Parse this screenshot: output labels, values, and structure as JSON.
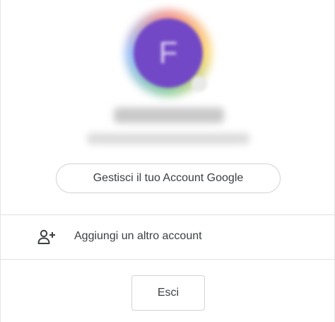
{
  "account": {
    "avatar_initial": "F",
    "avatar_color": "#7248c6"
  },
  "actions": {
    "manage_account_label": "Gestisci il tuo Account Google",
    "add_account_label": "Aggiungi un altro account",
    "add_account_icon": "person-add-icon",
    "sign_out_label": "Esci"
  }
}
